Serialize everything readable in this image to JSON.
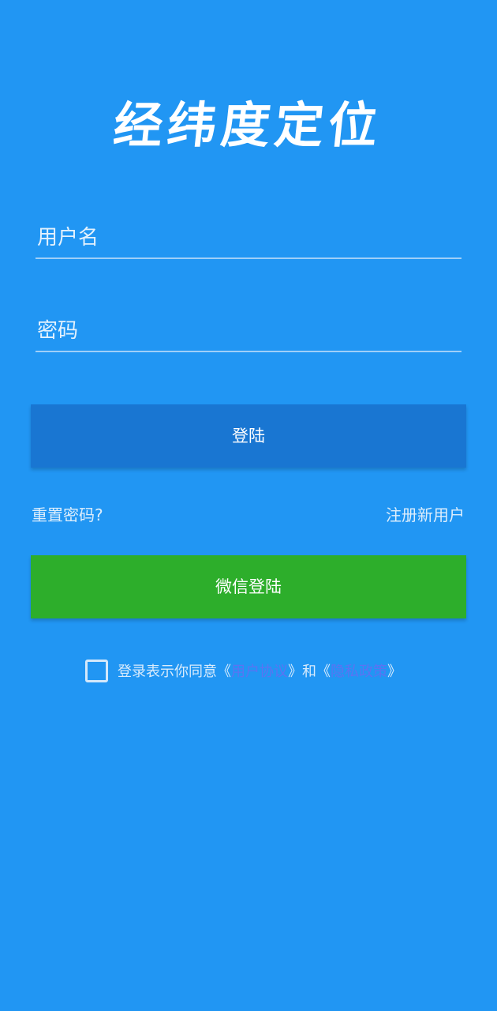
{
  "app": {
    "title": "经纬度定位"
  },
  "form": {
    "username_placeholder": "用户名",
    "password_placeholder": "密码"
  },
  "buttons": {
    "login_label": "登陆",
    "wechat_label": "微信登陆"
  },
  "links": {
    "reset_password": "重置密码?",
    "register": "注册新用户"
  },
  "agreement": {
    "prefix": "登录表示你同意",
    "open_bracket_1": "《",
    "user_agreement": "用户协议",
    "close_bracket_1": "》",
    "and": "和",
    "open_bracket_2": "《",
    "privacy_policy": "隐私政策",
    "close_bracket_2": "》"
  },
  "colors": {
    "background": "#2196F3",
    "login_button": "#1976D2",
    "wechat_button": "#2DAE2B",
    "link_highlight": "#5B73F2"
  }
}
